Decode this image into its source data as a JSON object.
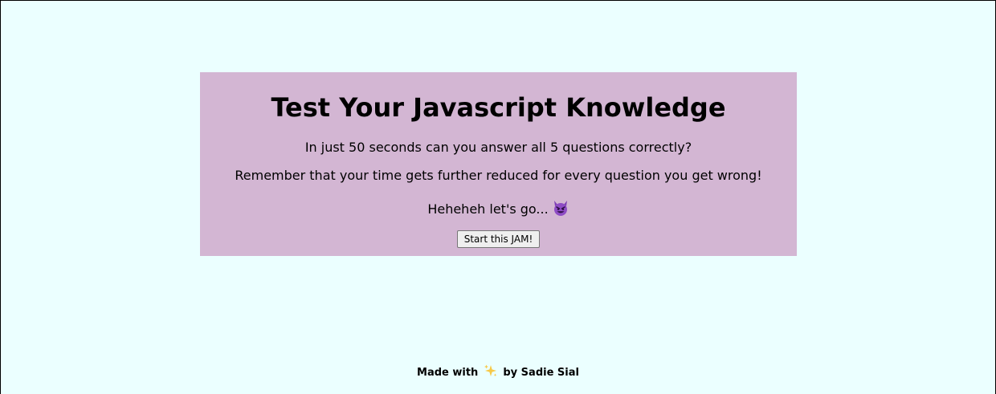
{
  "intro": {
    "title": "Test Your Javascript Knowledge",
    "line1": "In just 50 seconds can you answer all 5 questions correctly?",
    "line2": "Remember that your time gets further reduced for every question you get wrong!",
    "line3": "Heheheh let's go...",
    "line3_icon": "smiling-devil-icon",
    "start_button": "Start this JAM!"
  },
  "footer": {
    "prefix": "Made with",
    "icon": "sparkles-icon",
    "suffix": "by Sadie Sial"
  },
  "colors": {
    "page_background": "#ebffff",
    "card_background": "#d3b6d3",
    "devil_purple": "#7f3fb5",
    "sparkle_yellow": "#f7c948"
  }
}
